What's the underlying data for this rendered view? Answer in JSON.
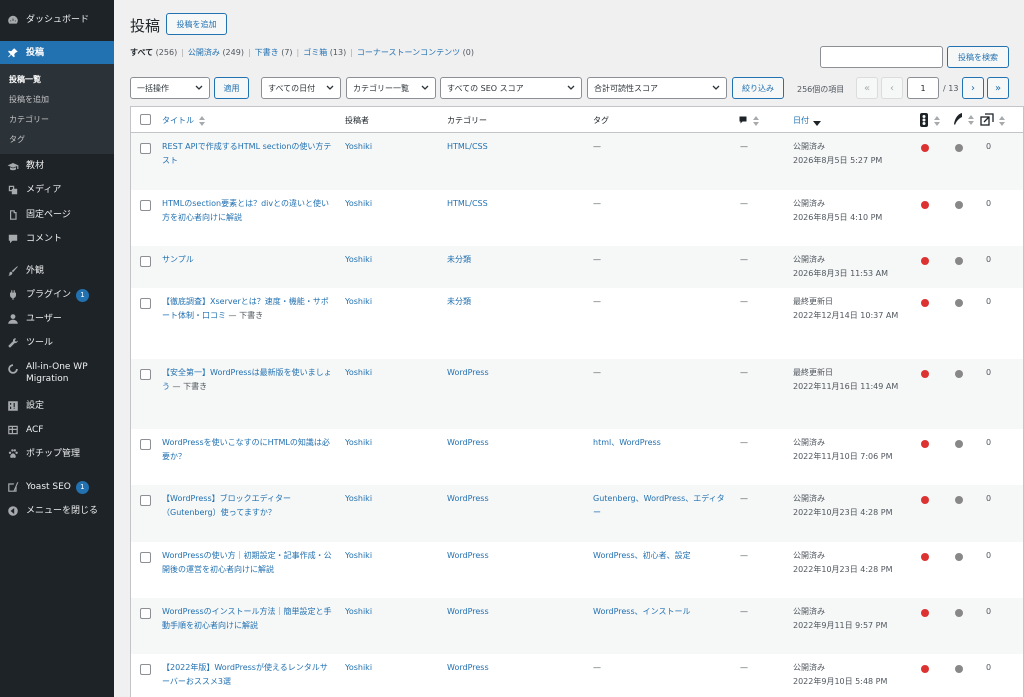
{
  "sidebar": {
    "items": [
      {
        "label": "ダッシュボード",
        "icon": "dashboard-icon"
      },
      {
        "label": "投稿",
        "icon": "pin-icon",
        "active": true
      },
      {
        "label": "教材",
        "icon": "book-icon"
      },
      {
        "label": "メディア",
        "icon": "media-icon"
      },
      {
        "label": "固定ページ",
        "icon": "page-icon"
      },
      {
        "label": "コメント",
        "icon": "comment-icon"
      },
      {
        "label": "外観",
        "icon": "brush-icon"
      },
      {
        "label": "プラグイン",
        "icon": "plugin-icon",
        "badge": "1"
      },
      {
        "label": "ユーザー",
        "icon": "user-icon"
      },
      {
        "label": "ツール",
        "icon": "wrench-icon"
      },
      {
        "label": "All-in-One WP Migration",
        "icon": "migration-icon"
      },
      {
        "label": "設定",
        "icon": "settings-icon"
      },
      {
        "label": "ACF",
        "icon": "grid-icon"
      },
      {
        "label": "ポチップ管理",
        "icon": "paw-icon"
      },
      {
        "label": "Yoast SEO",
        "icon": "yoast-icon",
        "badge": "1"
      },
      {
        "label": "メニューを閉じる",
        "icon": "collapse-icon"
      }
    ],
    "submenu": [
      "投稿一覧",
      "投稿を追加",
      "カテゴリー",
      "タグ"
    ]
  },
  "header": {
    "title": "投稿",
    "add_new": "投稿を追加"
  },
  "views": [
    {
      "label": "すべて",
      "count": "(256)"
    },
    {
      "label": "公開済み",
      "count": "(249)"
    },
    {
      "label": "下書き",
      "count": "(7)"
    },
    {
      "label": "ゴミ箱",
      "count": "(13)"
    },
    {
      "label": "コーナーストーンコンテンツ",
      "count": "(0)"
    }
  ],
  "search": {
    "button": "投稿を検索",
    "value": ""
  },
  "filters": {
    "bulk": "一括操作",
    "apply": "適用",
    "dates": "すべての日付",
    "categories": "カテゴリー一覧",
    "seo": "すべての SEO スコア",
    "readability": "合計可読性スコア",
    "filter_btn": "絞り込み"
  },
  "pagination": {
    "items": "256個の項目",
    "current": "1",
    "of": "/ 13",
    "first": "«",
    "prev": "‹",
    "next": "›",
    "last": "»"
  },
  "columns": {
    "title": "タイトル",
    "author": "投稿者",
    "category": "カテゴリー",
    "tags": "タグ",
    "date": "日付"
  },
  "rows": [
    {
      "title": "REST APIで作成するHTML sectionの使い方テスト",
      "state": "",
      "author": "Yoshiki",
      "category": "HTML/CSS",
      "tags": "—",
      "comments": "—",
      "status": "公開済み",
      "date": "2026年8月5日 5:27 PM",
      "links": "0"
    },
    {
      "title": "HTMLのsection要素とは？divとの違いと使い方を初心者向けに解説",
      "state": "",
      "author": "Yoshiki",
      "category": "HTML/CSS",
      "tags": "—",
      "comments": "—",
      "status": "公開済み",
      "date": "2026年8月5日 4:10 PM",
      "links": "0"
    },
    {
      "title": "サンプル",
      "state": "",
      "author": "Yoshiki",
      "category": "未分類",
      "tags": "—",
      "comments": "—",
      "status": "公開済み",
      "date": "2026年8月3日 11:53 AM",
      "links": "0"
    },
    {
      "title": "【徹底調査】Xserverとは？速度・機能・サポート体制・口コミ",
      "state": "— 下書き",
      "author": "Yoshiki",
      "category": "未分類",
      "tags": "—",
      "comments": "—",
      "status": "最終更新日",
      "date": "2022年12月14日 10:37 AM",
      "links": "0"
    },
    {
      "title": "【安全第一】WordPressは最新版を使いましょう",
      "state": "— 下書き",
      "author": "Yoshiki",
      "category": "WordPress",
      "tags": "—",
      "comments": "—",
      "status": "最終更新日",
      "date": "2022年11月16日 11:49 AM",
      "links": "0"
    },
    {
      "title": "WordPressを使いこなすのにHTMLの知識は必要か？",
      "state": "",
      "author": "Yoshiki",
      "category": "WordPress",
      "tags": "html、WordPress",
      "comments": "—",
      "status": "公開済み",
      "date": "2022年11月10日 7:06 PM",
      "links": "0"
    },
    {
      "title": "【WordPress】ブロックエディター（Gutenberg）使ってますか？",
      "state": "",
      "author": "Yoshiki",
      "category": "WordPress",
      "tags": "Gutenberg、WordPress、エディター",
      "comments": "—",
      "status": "公開済み",
      "date": "2022年10月23日 4:28 PM",
      "links": "0"
    },
    {
      "title": "WordPressの使い方｜初期設定・記事作成・公開後の運営を初心者向けに解説",
      "state": "",
      "author": "Yoshiki",
      "category": "WordPress",
      "tags": "WordPress、初心者、設定",
      "comments": "—",
      "status": "公開済み",
      "date": "2022年10月23日 4:28 PM",
      "links": "0"
    },
    {
      "title": "WordPressのインストール方法｜簡単設定と手動手順を初心者向けに解説",
      "state": "",
      "author": "Yoshiki",
      "category": "WordPress",
      "tags": "WordPress、インストール",
      "comments": "—",
      "status": "公開済み",
      "date": "2022年9月11日 9:57 PM",
      "links": "0"
    },
    {
      "title": "【2022年版】WordPressが使えるレンタルサーバーおススメ3選",
      "state": "",
      "author": "Yoshiki",
      "category": "WordPress",
      "tags": "—",
      "comments": "—",
      "status": "公開済み",
      "date": "2022年9月10日 5:48 PM",
      "links": "0"
    }
  ]
}
